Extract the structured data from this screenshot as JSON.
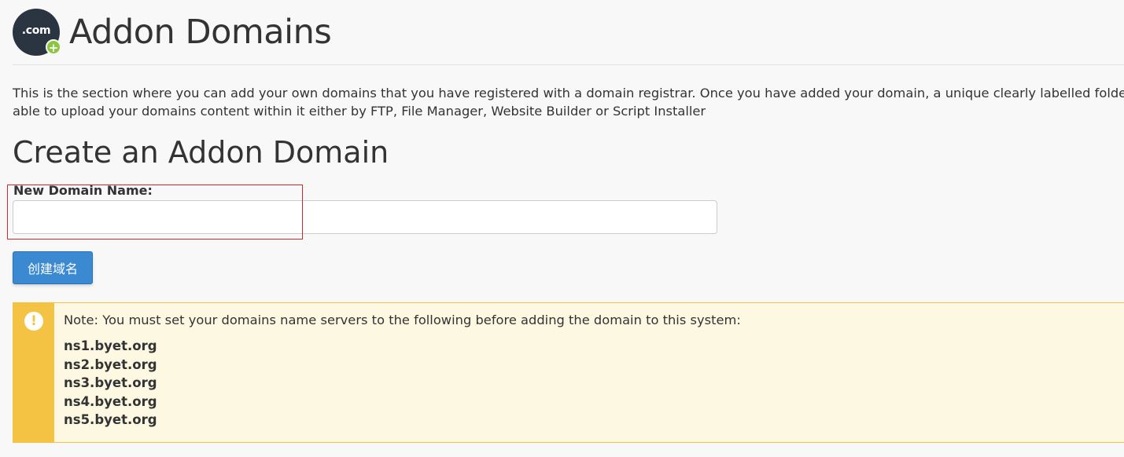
{
  "header": {
    "logo_text": ".com",
    "logo_badge": "+",
    "title": "Addon Domains"
  },
  "description": {
    "line1": "This is the section where you can add your own domains that you have registered with a domain registrar. Once you have added your domain, a unique clearly labelled folder",
    "line2": "able to upload your domains content within it either by FTP, File Manager, Website Builder or Script Installer"
  },
  "create_section": {
    "title": "Create an Addon Domain",
    "field_label": "New Domain Name:",
    "field_value": "",
    "field_placeholder": "",
    "button_label": "创建域名"
  },
  "alert": {
    "icon": "exclamation-icon",
    "note": "Note: You must set your domains name servers to the following before adding the domain to this system:",
    "nameservers": [
      "ns1.byet.org",
      "ns2.byet.org",
      "ns3.byet.org",
      "ns4.byet.org",
      "ns5.byet.org"
    ]
  },
  "colors": {
    "page_background": "#f8f8f8",
    "logo_background": "#2b3541",
    "logo_badge": "#8cc63f",
    "button": "#3a89d1",
    "alert_stripe": "#f5c343",
    "alert_background": "#fdf8e2",
    "highlight": "#d0262d"
  }
}
